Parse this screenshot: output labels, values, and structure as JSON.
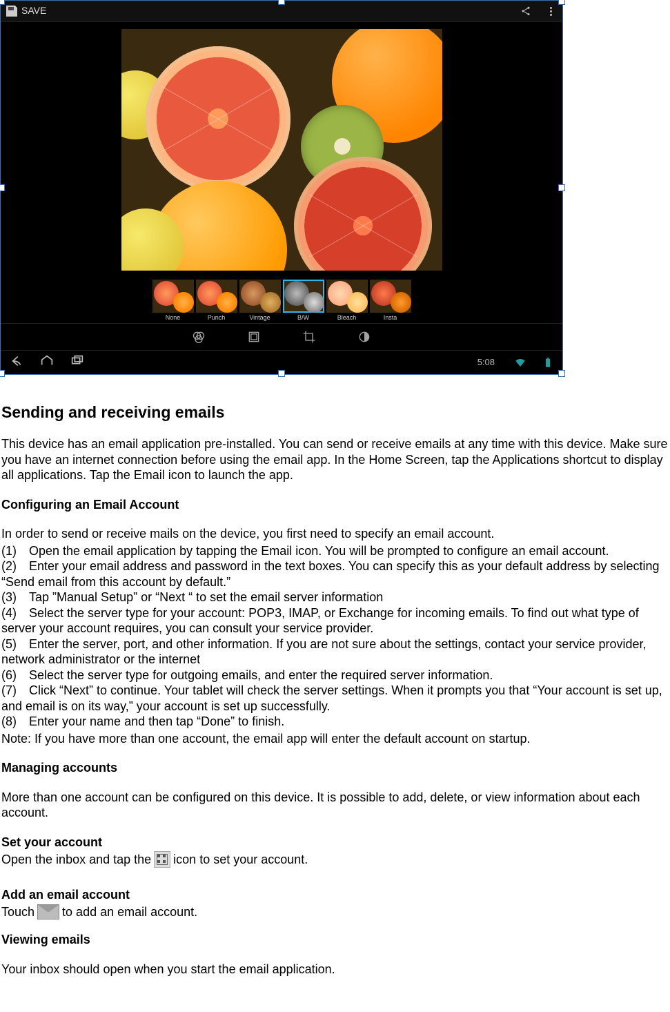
{
  "tablet": {
    "actionbar": {
      "save_label": "SAVE"
    },
    "filters": [
      {
        "label": "None",
        "cls": "none",
        "selected": false
      },
      {
        "label": "Punch",
        "cls": "punch",
        "selected": false
      },
      {
        "label": "Vintage",
        "cls": "vintage",
        "selected": false
      },
      {
        "label": "B/W",
        "cls": "bw",
        "selected": true
      },
      {
        "label": "Bleach",
        "cls": "bleach",
        "selected": false
      },
      {
        "label": "Insta",
        "cls": "insta",
        "selected": false
      }
    ],
    "navbar": {
      "time": "5:08"
    }
  },
  "doc": {
    "h_sending": "Sending and receiving emails",
    "intro": "This device has an email application pre-installed. You can send or receive emails at any time with this device. Make sure you have an internet connection before using the email app. In the Home Screen, tap the Applications shortcut to display all applications. Tap the Email icon to launch the app.",
    "h_config": "Configuring an Email Account",
    "config_intro": "In order to send or receive mails on the device, you first need to specify an email account.",
    "steps": [
      "(1) Open the email application by tapping the Email icon. You will be prompted to configure an email account.",
      "(2) Enter your email address and password in the text boxes. You can specify this as your default address by selecting “Send email from this account by default.”",
      "(3) Tap ”Manual Setup” or “Next “ to set the email server information",
      "(4) Select the server type for your account: POP3, IMAP, or Exchange for incoming emails. To find out what type of server your account requires, you can consult your service provider.",
      "(5) Enter the server, port, and other information. If you are not sure about the settings, contact your service provider, network administrator or the internet",
      "(6) Select the server type for outgoing emails, and enter the required server information.",
      "(7) Click “Next” to continue. Your tablet will check the server settings. When it prompts you that “Your account is set up, and email is on its way,” your account is set up successfully.",
      "(8) Enter your name and then tap “Done” to finish."
    ],
    "note": "Note: If you have more than one account, the email app will enter the default account on startup.",
    "h_managing": "Managing accounts",
    "managing_body": "More than one account can be configured on this device. It is possible to add, delete, or view information about each account.",
    "h_set": "Set your account",
    "set_pre": "Open the inbox and tap the ",
    "set_post": " icon to set your account.",
    "h_add": "Add an email account",
    "add_pre": "Touch ",
    "add_post": " to add an email account.",
    "h_view": "Viewing emails",
    "view_body": "Your inbox should open when you start the email application."
  }
}
